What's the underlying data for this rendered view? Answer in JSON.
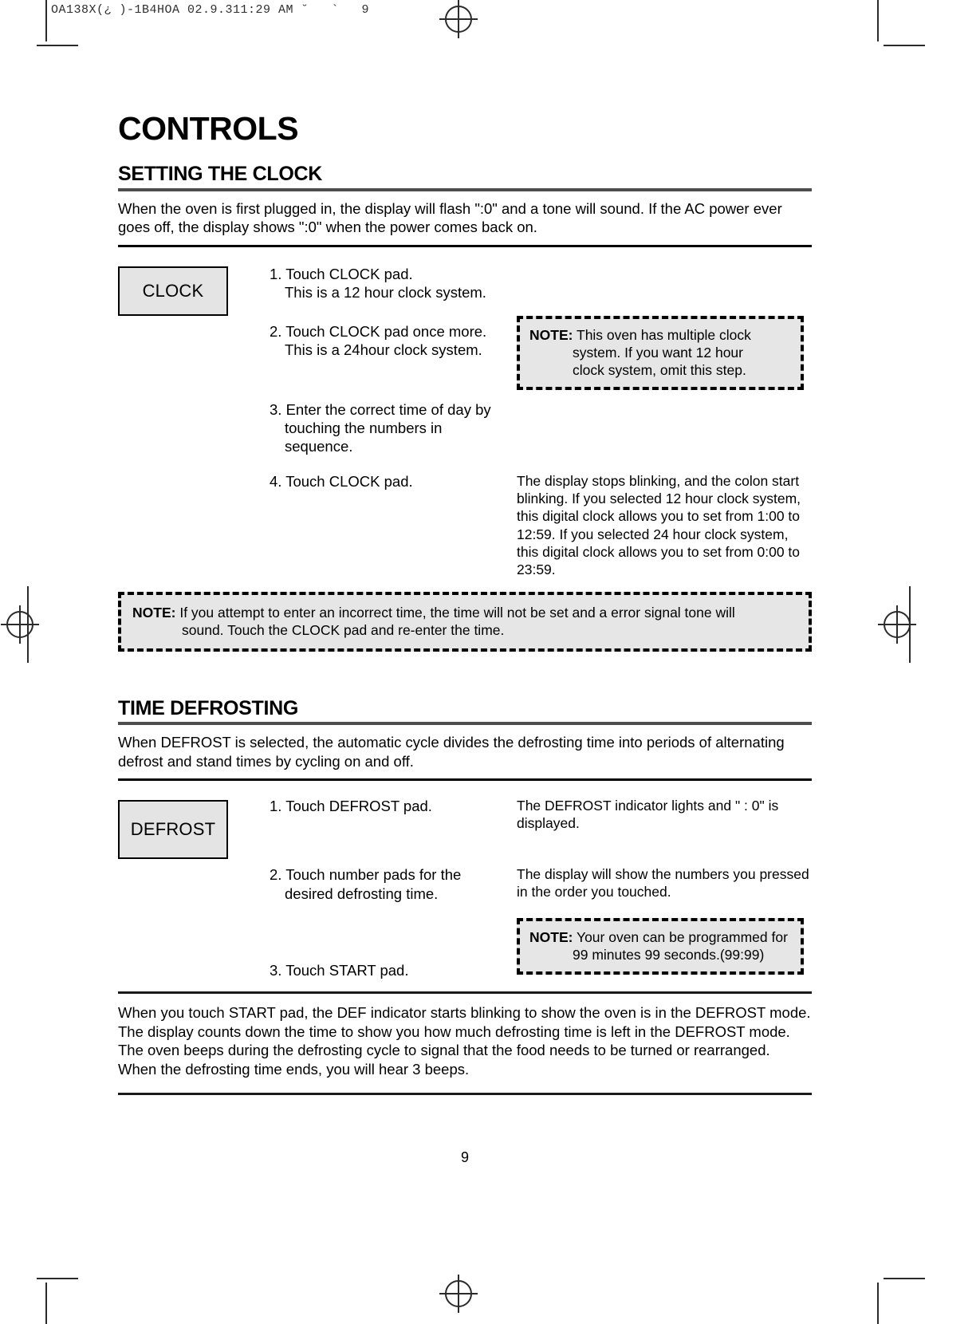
{
  "scan": {
    "header_text": "OA138X(¿ )-1B4HOA 02.9.311:29 AM ˘   `   9"
  },
  "document": {
    "title": "CONTROLS",
    "page_number": "9"
  },
  "clock_section": {
    "heading": "SETTING THE CLOCK",
    "intro": "When the oven is first plugged in, the display will flash \":0\" and a tone will sound. If the AC power ever goes off, the display shows \":0\" when the power  comes back on.",
    "pad_label": "CLOCK",
    "steps": [
      {
        "line1": "1. Touch CLOCK pad.",
        "line2": "This is a 12 hour clock system."
      },
      {
        "line1": "2. Touch CLOCK pad once more.",
        "line2": "This is a 24hour clock system."
      },
      {
        "line1": "3. Enter the correct time of day by",
        "line2": "touching the numbers in",
        "line3": "sequence."
      },
      {
        "line1": "4. Touch CLOCK pad.",
        "line2": "",
        "line3": ""
      }
    ],
    "note_12_24": {
      "label": "NOTE:",
      "line1": "This oven has multiple clock",
      "line2": "system. If you want 12 hour",
      "line3": "clock system, omit this step."
    },
    "step4_response": "The display stops blinking, and the colon start blinking. If you selected 12 hour clock system, this digital clock allows you to set from 1:00 to 12:59. If you selected 24 hour clock system, this digital clock allows you to set from 0:00 to 23:59.",
    "note_incorrect_time": {
      "label": "NOTE:",
      "line1": "If you attempt to enter an incorrect time, the time will not be set and a error signal tone will",
      "line2": "sound. Touch the CLOCK pad and re-enter the time."
    }
  },
  "defrost_section": {
    "heading": "TIME DEFROSTING",
    "intro": "When DEFROST is selected, the automatic cycle divides the defrosting time into periods of alternating defrost and stand times by cycling on and off.",
    "pad_label": "DEFROST",
    "steps": [
      {
        "line1": "1. Touch DEFROST pad.",
        "line2": ""
      },
      {
        "line1": "2. Touch number pads for the",
        "line2": "desired defrosting time."
      },
      {
        "line1": "3. Touch START pad.",
        "line2": ""
      }
    ],
    "responses": [
      "The DEFROST indicator lights and \" : 0\" is displayed.",
      "The display will show the numbers you pressed in the order you touched."
    ],
    "note_99": {
      "label": "NOTE:",
      "line1": "Your oven can be programmed for",
      "line2": "99 minutes 99 seconds.(99:99)"
    },
    "closing": "When you touch START pad, the DEF indicator starts blinking to show the oven is in the DEFROST mode. The display counts down the time to show you how much defrosting time is left in the DEFROST mode. The oven beeps during the defrosting cycle to signal that the food needs to be turned or rearranged. When the defrosting time ends, you will hear 3 beeps."
  },
  "colors": {
    "pad_fill": "#e4e4e4",
    "note_fill": "#e6e6e6",
    "rule": "#4d4d4d"
  }
}
